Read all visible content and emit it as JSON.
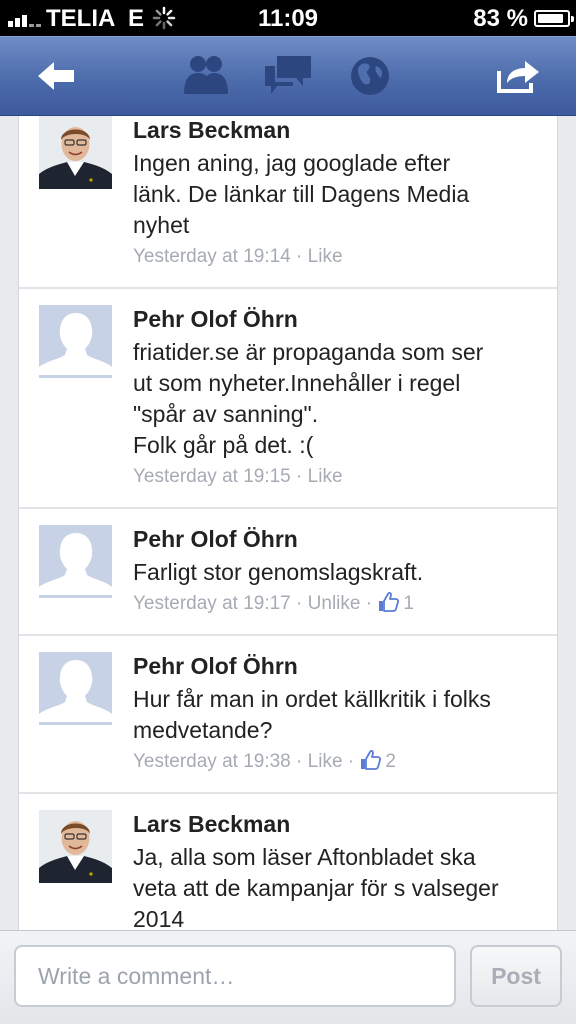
{
  "status_bar": {
    "carrier": "TELIA",
    "network": "E",
    "time": "11:09",
    "battery": "83 %",
    "battery_level": 0.83
  },
  "nav": {
    "back_icon": "back-arrow-icon",
    "friends_icon": "friend-requests-icon",
    "messages_icon": "messages-icon",
    "notifications_icon": "globe-notifications-icon",
    "share_icon": "share-icon"
  },
  "comments": [
    {
      "author": "Lars Beckman",
      "text": "Ingen aning, jag googlade efter\nlänk. De länkar till Dagens Media\nnyhet",
      "time": "Yesterday at 19:14",
      "action": "Like",
      "likes": "",
      "avatar": "photo"
    },
    {
      "author": "Pehr Olof Öhrn",
      "text": "friatider.se är propaganda som ser\nut som nyheter.Innehåller i regel\n\"spår av sanning\".\nFolk går på det. :(",
      "time": "Yesterday at 19:15",
      "action": "Like",
      "likes": "",
      "avatar": "placeholder"
    },
    {
      "author": "Pehr Olof Öhrn",
      "text": "Farligt stor genomslagskraft.",
      "time": "Yesterday at 19:17",
      "action": "Unlike",
      "likes": "1",
      "avatar": "placeholder"
    },
    {
      "author": "Pehr Olof Öhrn",
      "text": "Hur får man in ordet källkritik i folks\nmedvetande?",
      "time": "Yesterday at 19:38",
      "action": "Like",
      "likes": "2",
      "avatar": "placeholder"
    },
    {
      "author": "Lars Beckman",
      "text": "Ja, alla som läser Aftonbladet ska\nveta att de kampanjar för s valseger\n2014",
      "time": "",
      "action": "",
      "likes": "",
      "avatar": "photo"
    }
  ],
  "composer": {
    "placeholder": "Write a comment…",
    "post_label": "Post"
  },
  "colors": {
    "nav": "#4f6ead",
    "link": "#3b5998",
    "meta": "#a6abb3"
  }
}
